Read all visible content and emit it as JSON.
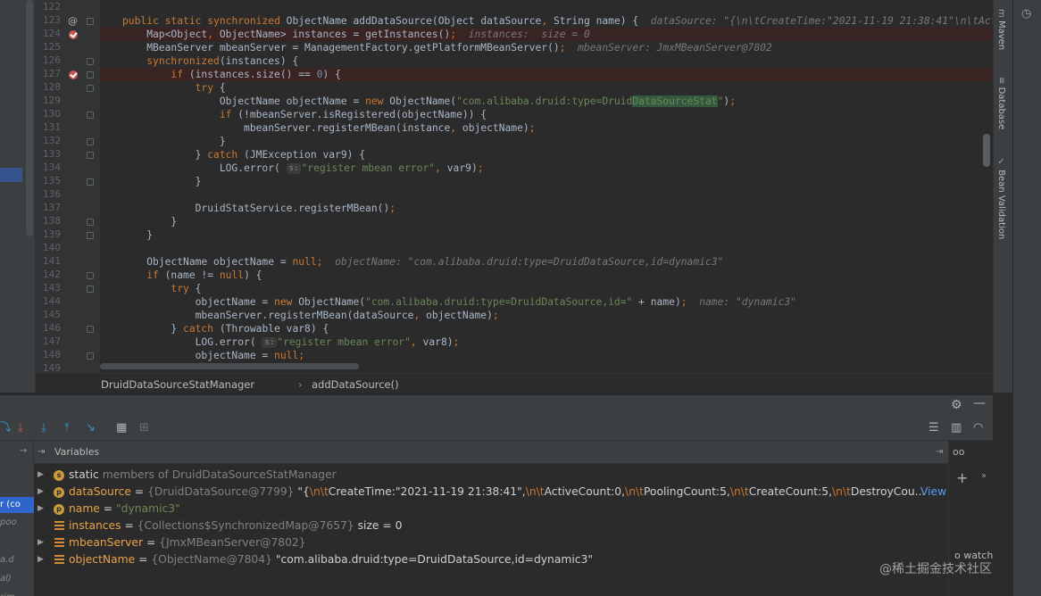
{
  "editor": {
    "lines": [
      {
        "n": "122",
        "code": ""
      },
      {
        "n": "123",
        "code": "public static synchronized ObjectName addDataSource(Object dataSource, String name) {",
        "hint": "dataSource: \"{\\n\\tCreateTime:\"2021-11-19 21:38:41\"\\n\\tActiveCount:"
      },
      {
        "n": "124",
        "code": "    Map<Object, ObjectName> instances = getInstances();",
        "hint": "instances:  size = 0"
      },
      {
        "n": "125",
        "code": "    MBeanServer mbeanServer = ManagementFactory.getPlatformMBeanServer();",
        "hint": "mbeanServer: JmxMBeanServer@7802"
      },
      {
        "n": "126",
        "code": "    synchronized(instances) {"
      },
      {
        "n": "127",
        "code": "        if (instances.size() == 0) {"
      },
      {
        "n": "128",
        "code": "            try {"
      },
      {
        "n": "129",
        "code": "                ObjectName objectName = new ObjectName(\"com.alibaba.druid:type=DruidDataSourceStat\");"
      },
      {
        "n": "130",
        "code": "                if (!mbeanServer.isRegistered(objectName)) {"
      },
      {
        "n": "131",
        "code": "                    mbeanServer.registerMBean(instance, objectName);"
      },
      {
        "n": "132",
        "code": "                }"
      },
      {
        "n": "133",
        "code": "            } catch (JMException var9) {"
      },
      {
        "n": "134",
        "code": "                LOG.error( \"register mbean error\", var9);"
      },
      {
        "n": "135",
        "code": "            }"
      },
      {
        "n": "136",
        "code": ""
      },
      {
        "n": "137",
        "code": "            DruidStatService.registerMBean();"
      },
      {
        "n": "138",
        "code": "        }"
      },
      {
        "n": "139",
        "code": "    }"
      },
      {
        "n": "140",
        "code": ""
      },
      {
        "n": "141",
        "code": "    ObjectName objectName = null;",
        "hint": "objectName: \"com.alibaba.druid:type=DruidDataSource,id=dynamic3\""
      },
      {
        "n": "142",
        "code": "    if (name != null) {"
      },
      {
        "n": "143",
        "code": "        try {"
      },
      {
        "n": "144",
        "code": "            objectName = new ObjectName(\"com.alibaba.druid:type=DruidDataSource,id=\" + name);",
        "hint": "name: \"dynamic3\""
      },
      {
        "n": "145",
        "code": "            mbeanServer.registerMBean(dataSource, objectName);"
      },
      {
        "n": "146",
        "code": "        } catch (Throwable var8) {"
      },
      {
        "n": "147",
        "code": "            LOG.error( \"register mbean error\", var8);"
      },
      {
        "n": "148",
        "code": "            objectName = null;"
      },
      {
        "n": "149",
        "code": ""
      }
    ],
    "param_hint": "s:"
  },
  "breadcrumb": {
    "class_name": "DruidDataSourceStatManager",
    "method_name": "addDataSource()",
    "separator": "›"
  },
  "right_tabs": {
    "maven": "Maven",
    "database": "Database",
    "bean_validation": "Bean Validation"
  },
  "debug": {
    "variables_label": "Variables",
    "view_link": "View",
    "watch_label": "o watch",
    "variables": [
      {
        "badge": "s",
        "name": "static",
        "rest": "members of DruidDataSourceStatManager",
        "expandable": true
      },
      {
        "badge": "p",
        "name": "dataSource",
        "type": "{DruidDataSource@7799}",
        "value": "\"{\\n\\tCreateTime:\"2021-11-19 21:38:41\",\\n\\tActiveCount:0,\\n\\tPoolingCount:5,\\n\\tCreateCount:5,\\n\\tDestroyCou...",
        "expandable": true
      },
      {
        "badge": "p",
        "name": "name",
        "value": "\"dynamic3\"",
        "expandable": true
      },
      {
        "badge": "f",
        "name": "instances",
        "type": "{Collections$SynchronizedMap@7657}",
        "value": "size = 0",
        "expandable": false
      },
      {
        "badge": "f",
        "name": "mbeanServer",
        "type": "{JmxMBeanServer@7802}",
        "value": "",
        "expandable": true
      },
      {
        "badge": "f",
        "name": "objectName",
        "type": "{ObjectName@7804}",
        "value": "\"com.alibaba.druid:type=DruidDataSource,id=dynamic3\"",
        "expandable": true
      }
    ],
    "frames": [
      "r (co",
      "poo",
      "",
      "a.d",
      "al)",
      "rim"
    ]
  },
  "watermark": "@稀土掘金技术社区"
}
